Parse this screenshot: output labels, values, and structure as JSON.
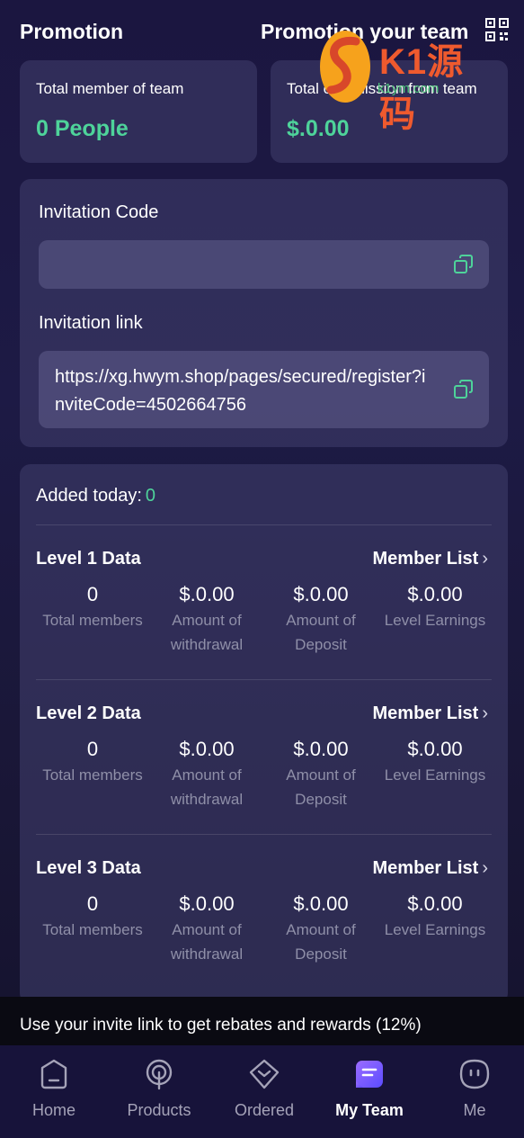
{
  "header": {
    "title": "Promotion",
    "right_title": "Promotion your team"
  },
  "watermark": {
    "text": "K1源码",
    "sub": "k1ym.com"
  },
  "stats": {
    "members_label": "Total member of team",
    "members_value": "0 People",
    "commission_label": "Total commission from team",
    "commission_value": "$.0.00"
  },
  "invite": {
    "code_label": "Invitation Code",
    "code_value": "",
    "link_label": "Invitation link",
    "link_value": "https://xg.hwym.shop/pages/secured/register?inviteCode=4502664756"
  },
  "added_today": {
    "label": "Added today:",
    "value": "0"
  },
  "levels": [
    {
      "title": "Level 1 Data",
      "member_list": "Member List",
      "total_members": "0",
      "total_members_label": "Total members",
      "withdrawal": "$.0.00",
      "withdrawal_label": "Amount of withdrawal",
      "deposit": "$.0.00",
      "deposit_label": "Amount of Deposit",
      "earnings": "$.0.00",
      "earnings_label": "Level Earnings"
    },
    {
      "title": "Level 2 Data",
      "member_list": "Member List",
      "total_members": "0",
      "total_members_label": "Total members",
      "withdrawal": "$.0.00",
      "withdrawal_label": "Amount of withdrawal",
      "deposit": "$.0.00",
      "deposit_label": "Amount of Deposit",
      "earnings": "$.0.00",
      "earnings_label": "Level Earnings"
    },
    {
      "title": "Level 3 Data",
      "member_list": "Member List",
      "total_members": "0",
      "total_members_label": "Total members",
      "withdrawal": "$.0.00",
      "withdrawal_label": "Amount of withdrawal",
      "deposit": "$.0.00",
      "deposit_label": "Amount of Deposit",
      "earnings": "$.0.00",
      "earnings_label": "Level Earnings"
    }
  ],
  "rebate_text": "Use your invite link to get rebates and rewards (12%)",
  "tabs": [
    {
      "label": "Home",
      "icon": "home-icon"
    },
    {
      "label": "Products",
      "icon": "products-icon"
    },
    {
      "label": "Ordered",
      "icon": "ordered-icon"
    },
    {
      "label": "My Team",
      "icon": "team-icon",
      "active": true
    },
    {
      "label": "Me",
      "icon": "me-icon"
    }
  ],
  "colors": {
    "accent_green": "#4ed39a",
    "active_tab": "#7b5cff"
  }
}
